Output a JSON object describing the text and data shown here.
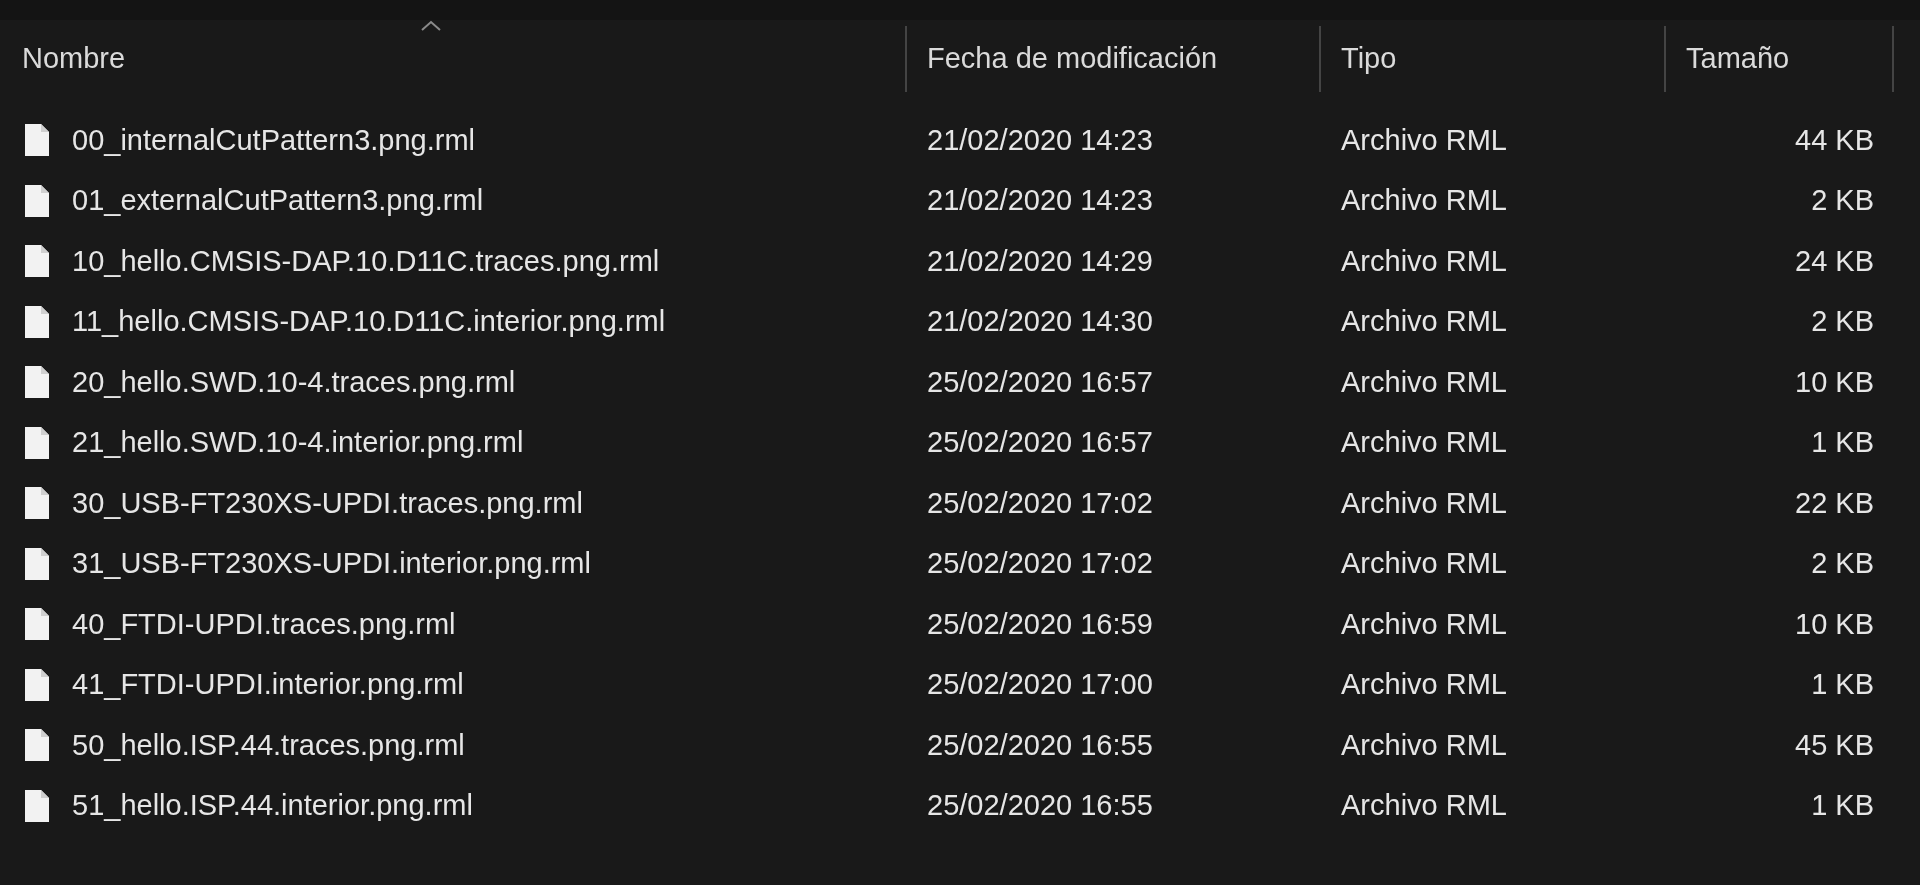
{
  "columns": [
    {
      "label": "Nombre",
      "sorted": true
    },
    {
      "label": "Fecha de modificación",
      "sorted": false
    },
    {
      "label": "Tipo",
      "sorted": false
    },
    {
      "label": "Tamaño",
      "sorted": false
    }
  ],
  "files": [
    {
      "name": "00_internalCutPattern3.png.rml",
      "date": "21/02/2020 14:23",
      "type": "Archivo RML",
      "size": "44 KB"
    },
    {
      "name": "01_externalCutPattern3.png.rml",
      "date": "21/02/2020 14:23",
      "type": "Archivo RML",
      "size": "2 KB"
    },
    {
      "name": "10_hello.CMSIS-DAP.10.D11C.traces.png.rml",
      "date": "21/02/2020 14:29",
      "type": "Archivo RML",
      "size": "24 KB"
    },
    {
      "name": "11_hello.CMSIS-DAP.10.D11C.interior.png.rml",
      "date": "21/02/2020 14:30",
      "type": "Archivo RML",
      "size": "2 KB"
    },
    {
      "name": "20_hello.SWD.10-4.traces.png.rml",
      "date": "25/02/2020 16:57",
      "type": "Archivo RML",
      "size": "10 KB"
    },
    {
      "name": "21_hello.SWD.10-4.interior.png.rml",
      "date": "25/02/2020 16:57",
      "type": "Archivo RML",
      "size": "1 KB"
    },
    {
      "name": "30_USB-FT230XS-UPDI.traces.png.rml",
      "date": "25/02/2020 17:02",
      "type": "Archivo RML",
      "size": "22 KB"
    },
    {
      "name": "31_USB-FT230XS-UPDI.interior.png.rml",
      "date": "25/02/2020 17:02",
      "type": "Archivo RML",
      "size": "2 KB"
    },
    {
      "name": "40_FTDI-UPDI.traces.png.rml",
      "date": "25/02/2020 16:59",
      "type": "Archivo RML",
      "size": "10 KB"
    },
    {
      "name": "41_FTDI-UPDI.interior.png.rml",
      "date": "25/02/2020 17:00",
      "type": "Archivo RML",
      "size": "1 KB"
    },
    {
      "name": "50_hello.ISP.44.traces.png.rml",
      "date": "25/02/2020 16:55",
      "type": "Archivo RML",
      "size": "45 KB"
    },
    {
      "name": "51_hello.ISP.44.interior.png.rml",
      "date": "25/02/2020 16:55",
      "type": "Archivo RML",
      "size": "1 KB"
    }
  ]
}
